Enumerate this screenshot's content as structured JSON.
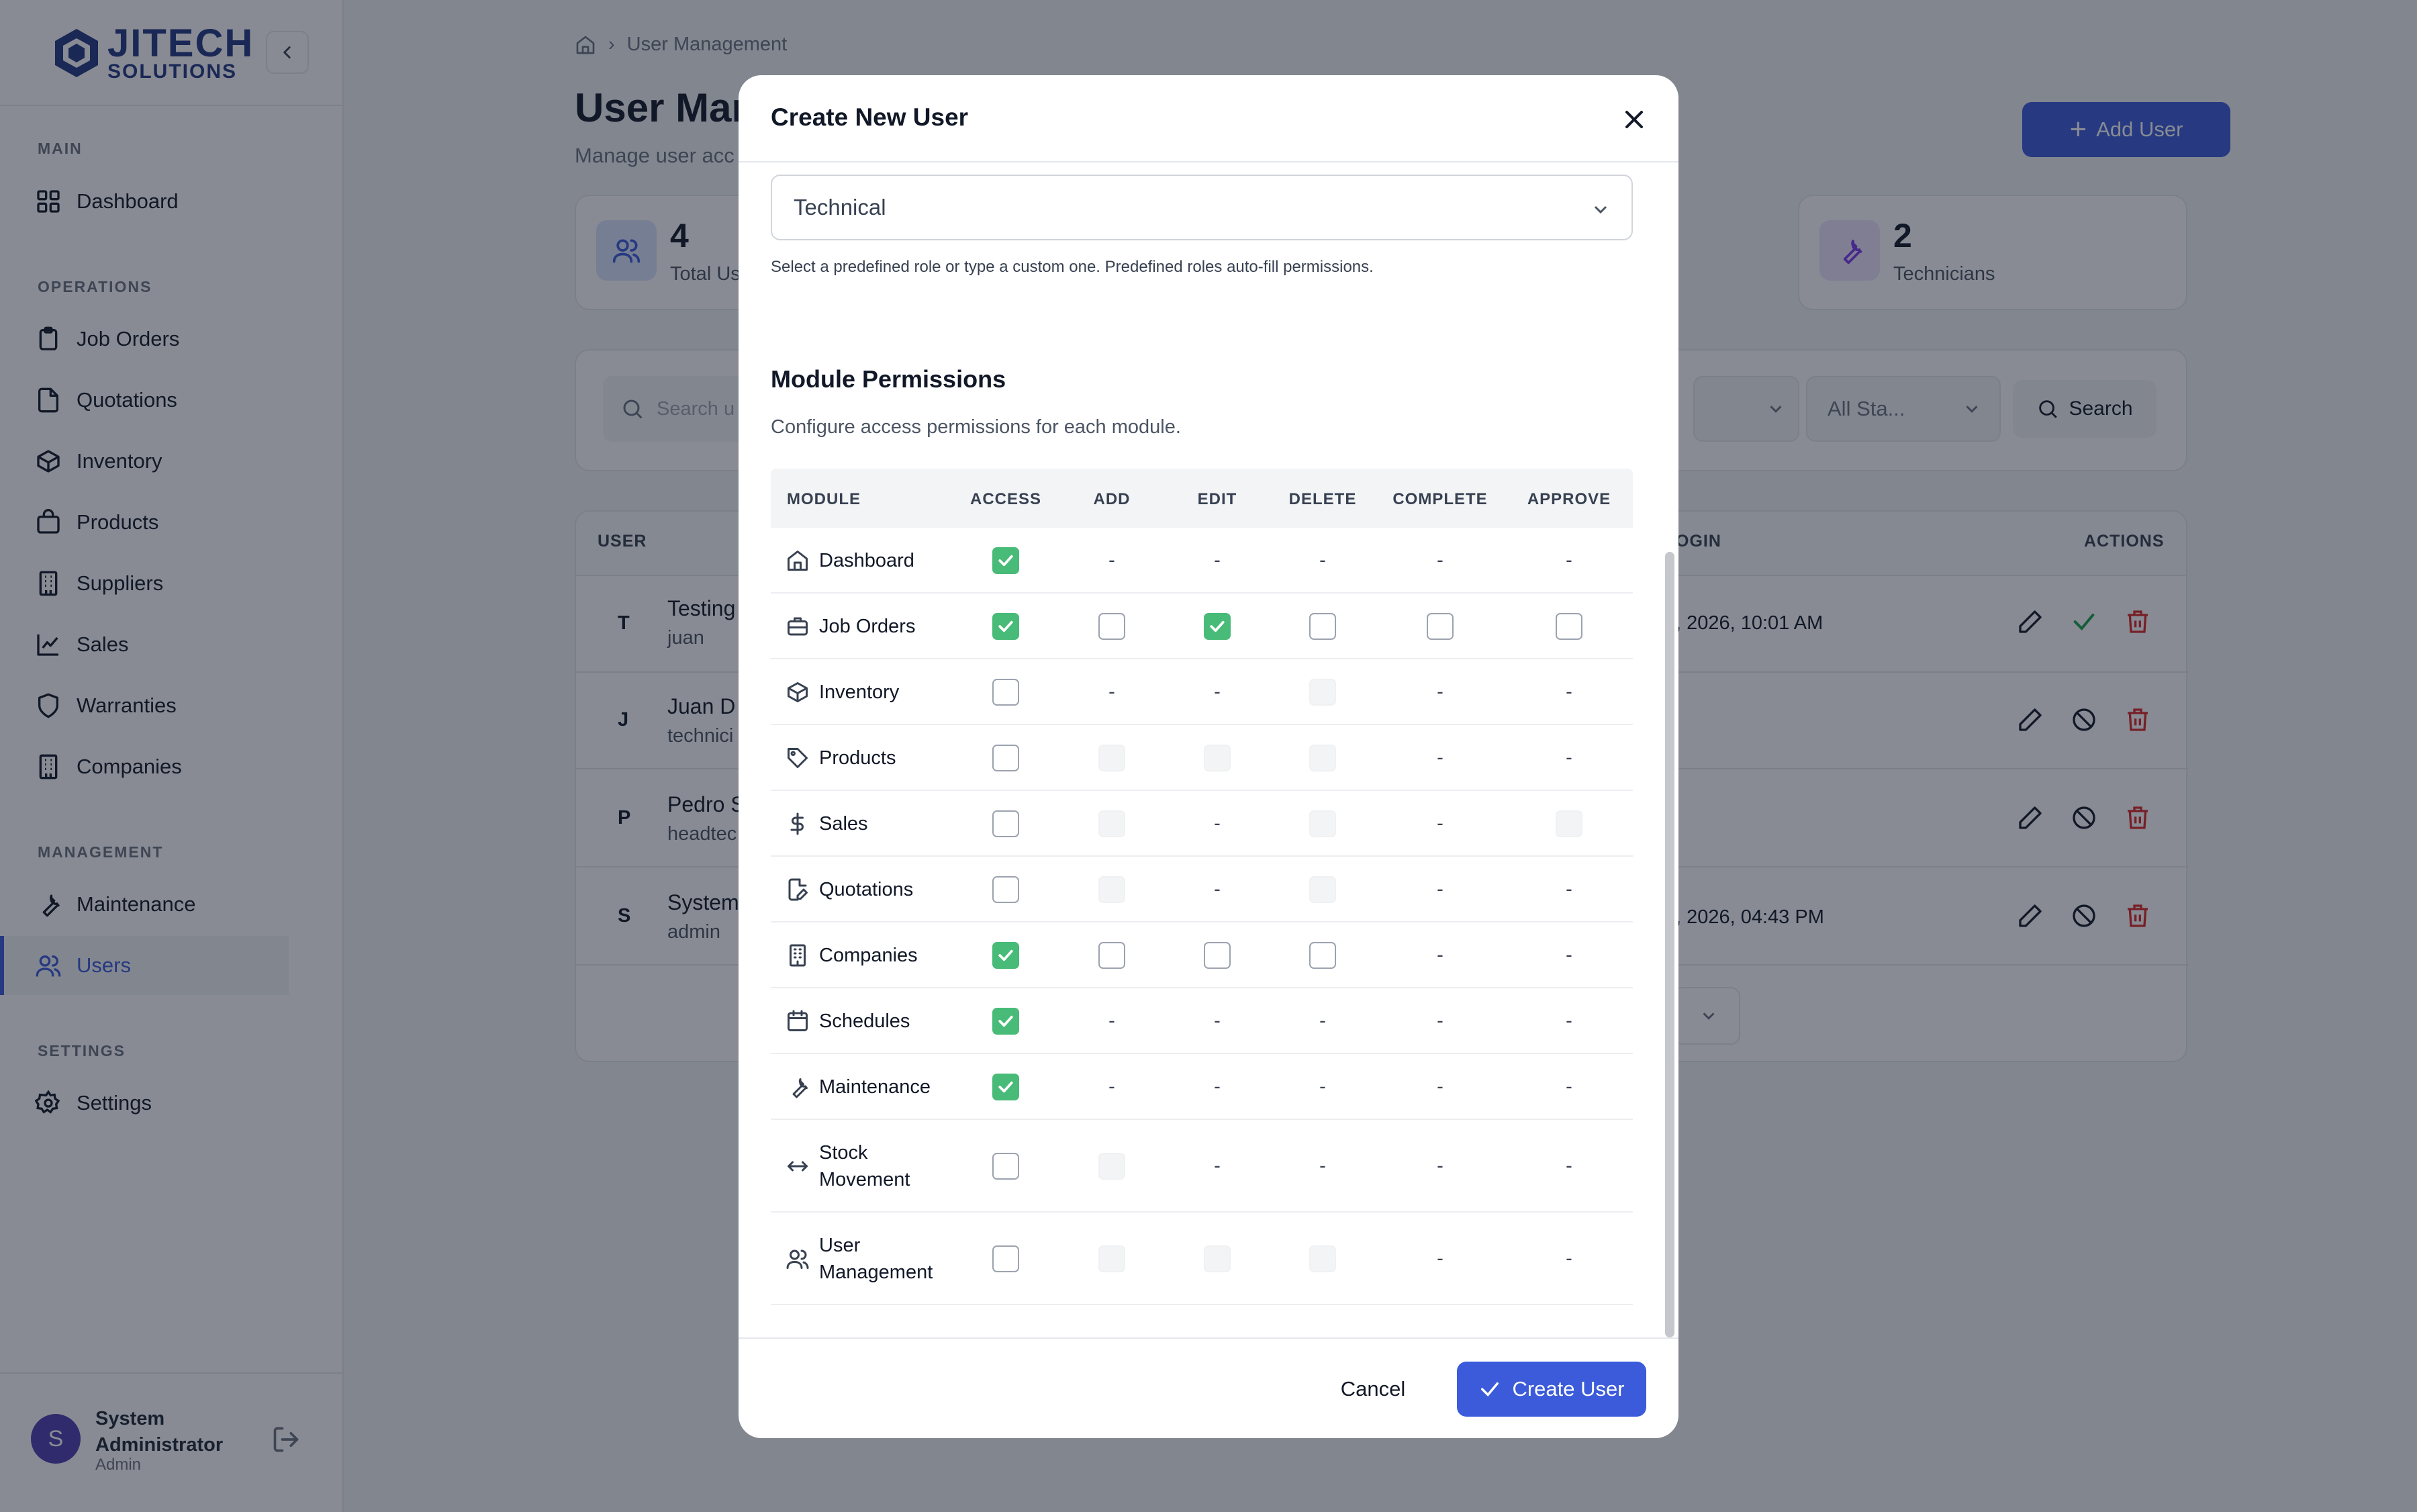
{
  "brand": {
    "line1": "JITECH",
    "line2": "SOLUTIONS"
  },
  "sidebar": {
    "sections": {
      "main": "MAIN",
      "operations": "OPERATIONS",
      "management": "MANAGEMENT",
      "settings": "SETTINGS"
    },
    "items": {
      "dashboard": "Dashboard",
      "job_orders": "Job Orders",
      "quotations": "Quotations",
      "inventory": "Inventory",
      "products": "Products",
      "suppliers": "Suppliers",
      "sales": "Sales",
      "warranties": "Warranties",
      "companies": "Companies",
      "maintenance": "Maintenance",
      "users": "Users",
      "settings": "Settings"
    },
    "active": "users",
    "user": {
      "initial": "S",
      "name": "System Administrator",
      "role": "Admin"
    }
  },
  "page": {
    "breadcrumb": "User Management",
    "title": "User Mar",
    "subtitle": "Manage user acc",
    "add_user_label": "Add User",
    "stats": [
      {
        "value": "4",
        "label": "Total Us"
      },
      {
        "value": "2",
        "label": "Technicians"
      }
    ],
    "search_placeholder": "Search u",
    "status_filter": "All Sta...",
    "search_button": "Search",
    "table": {
      "headers": {
        "user": "USER",
        "login": "OGIN",
        "actions": "ACTIONS"
      },
      "rows": [
        {
          "initial": "T",
          "name": "Testing",
          "sub": "juan",
          "last_login": ", 2026, 10:01 AM"
        },
        {
          "initial": "J",
          "name": "Juan D",
          "sub": "technici",
          "last_login": ""
        },
        {
          "initial": "P",
          "name": "Pedro S",
          "sub": "headtec",
          "last_login": ""
        },
        {
          "initial": "S",
          "name": "System",
          "sub": "admin",
          "last_login": ", 2026, 04:43 PM"
        }
      ]
    }
  },
  "modal": {
    "title": "Create New User",
    "role_value": "Technical",
    "role_help": "Select a predefined role or type a custom one. Predefined roles auto-fill permissions.",
    "permissions_title": "Module Permissions",
    "permissions_sub": "Configure access permissions for each module.",
    "columns": [
      "MODULE",
      "ACCESS",
      "ADD",
      "EDIT",
      "DELETE",
      "COMPLETE",
      "APPROVE"
    ],
    "dash_text": "-",
    "modules": [
      {
        "name": "Dashboard",
        "icon": "home-icon",
        "cells": [
          "on",
          "-",
          "-",
          "-",
          "-",
          "-"
        ]
      },
      {
        "name": "Job Orders",
        "icon": "briefcase-icon",
        "cells": [
          "on",
          "off",
          "on",
          "off",
          "off",
          "off"
        ]
      },
      {
        "name": "Inventory",
        "icon": "box-icon",
        "cells": [
          "off",
          "-",
          "-",
          "dis",
          "-",
          "-"
        ]
      },
      {
        "name": "Products",
        "icon": "tag-icon",
        "cells": [
          "off",
          "dis",
          "dis",
          "dis",
          "-",
          "-"
        ]
      },
      {
        "name": "Sales",
        "icon": "dollar-icon",
        "cells": [
          "off",
          "dis",
          "-",
          "dis",
          "-",
          "dis"
        ]
      },
      {
        "name": "Quotations",
        "icon": "file-pen-icon",
        "cells": [
          "off",
          "dis",
          "-",
          "dis",
          "-",
          "-"
        ]
      },
      {
        "name": "Companies",
        "icon": "building-icon",
        "cells": [
          "on",
          "off",
          "off",
          "off",
          "-",
          "-"
        ]
      },
      {
        "name": "Schedules",
        "icon": "calendar-icon",
        "cells": [
          "on",
          "-",
          "-",
          "-",
          "-",
          "-"
        ]
      },
      {
        "name": "Maintenance",
        "icon": "wrench-icon",
        "cells": [
          "on",
          "-",
          "-",
          "-",
          "-",
          "-"
        ]
      },
      {
        "name": "Stock Movement",
        "icon": "arrows-horizontal-icon",
        "cells": [
          "off",
          "dis",
          "-",
          "-",
          "-",
          "-"
        ]
      },
      {
        "name": "User Management",
        "icon": "users-icon",
        "cells": [
          "off",
          "dis",
          "dis",
          "dis",
          "-",
          "-"
        ]
      }
    ],
    "cancel_label": "Cancel",
    "create_label": "Create User"
  },
  "colors": {
    "accent": "#3b5bdb",
    "checked": "#48bb78",
    "brand": "#233884",
    "danger": "#dc2626"
  }
}
